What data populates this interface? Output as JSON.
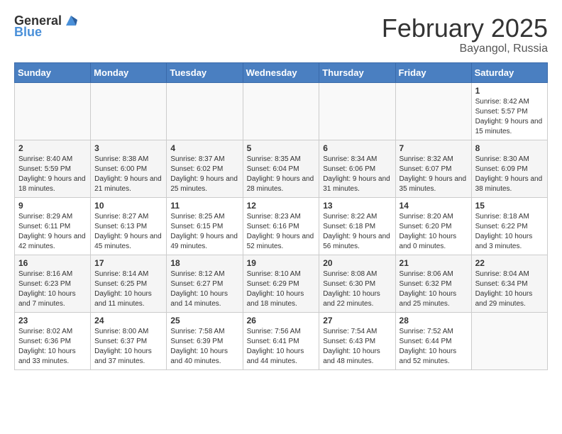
{
  "header": {
    "logo_general": "General",
    "logo_blue": "Blue",
    "month_year": "February 2025",
    "location": "Bayangol, Russia"
  },
  "days_of_week": [
    "Sunday",
    "Monday",
    "Tuesday",
    "Wednesday",
    "Thursday",
    "Friday",
    "Saturday"
  ],
  "weeks": [
    {
      "days": [
        {
          "number": "",
          "info": ""
        },
        {
          "number": "",
          "info": ""
        },
        {
          "number": "",
          "info": ""
        },
        {
          "number": "",
          "info": ""
        },
        {
          "number": "",
          "info": ""
        },
        {
          "number": "",
          "info": ""
        },
        {
          "number": "1",
          "info": "Sunrise: 8:42 AM\nSunset: 5:57 PM\nDaylight: 9 hours and 15 minutes."
        }
      ]
    },
    {
      "days": [
        {
          "number": "2",
          "info": "Sunrise: 8:40 AM\nSunset: 5:59 PM\nDaylight: 9 hours and 18 minutes."
        },
        {
          "number": "3",
          "info": "Sunrise: 8:38 AM\nSunset: 6:00 PM\nDaylight: 9 hours and 21 minutes."
        },
        {
          "number": "4",
          "info": "Sunrise: 8:37 AM\nSunset: 6:02 PM\nDaylight: 9 hours and 25 minutes."
        },
        {
          "number": "5",
          "info": "Sunrise: 8:35 AM\nSunset: 6:04 PM\nDaylight: 9 hours and 28 minutes."
        },
        {
          "number": "6",
          "info": "Sunrise: 8:34 AM\nSunset: 6:06 PM\nDaylight: 9 hours and 31 minutes."
        },
        {
          "number": "7",
          "info": "Sunrise: 8:32 AM\nSunset: 6:07 PM\nDaylight: 9 hours and 35 minutes."
        },
        {
          "number": "8",
          "info": "Sunrise: 8:30 AM\nSunset: 6:09 PM\nDaylight: 9 hours and 38 minutes."
        }
      ]
    },
    {
      "days": [
        {
          "number": "9",
          "info": "Sunrise: 8:29 AM\nSunset: 6:11 PM\nDaylight: 9 hours and 42 minutes."
        },
        {
          "number": "10",
          "info": "Sunrise: 8:27 AM\nSunset: 6:13 PM\nDaylight: 9 hours and 45 minutes."
        },
        {
          "number": "11",
          "info": "Sunrise: 8:25 AM\nSunset: 6:15 PM\nDaylight: 9 hours and 49 minutes."
        },
        {
          "number": "12",
          "info": "Sunrise: 8:23 AM\nSunset: 6:16 PM\nDaylight: 9 hours and 52 minutes."
        },
        {
          "number": "13",
          "info": "Sunrise: 8:22 AM\nSunset: 6:18 PM\nDaylight: 9 hours and 56 minutes."
        },
        {
          "number": "14",
          "info": "Sunrise: 8:20 AM\nSunset: 6:20 PM\nDaylight: 10 hours and 0 minutes."
        },
        {
          "number": "15",
          "info": "Sunrise: 8:18 AM\nSunset: 6:22 PM\nDaylight: 10 hours and 3 minutes."
        }
      ]
    },
    {
      "days": [
        {
          "number": "16",
          "info": "Sunrise: 8:16 AM\nSunset: 6:23 PM\nDaylight: 10 hours and 7 minutes."
        },
        {
          "number": "17",
          "info": "Sunrise: 8:14 AM\nSunset: 6:25 PM\nDaylight: 10 hours and 11 minutes."
        },
        {
          "number": "18",
          "info": "Sunrise: 8:12 AM\nSunset: 6:27 PM\nDaylight: 10 hours and 14 minutes."
        },
        {
          "number": "19",
          "info": "Sunrise: 8:10 AM\nSunset: 6:29 PM\nDaylight: 10 hours and 18 minutes."
        },
        {
          "number": "20",
          "info": "Sunrise: 8:08 AM\nSunset: 6:30 PM\nDaylight: 10 hours and 22 minutes."
        },
        {
          "number": "21",
          "info": "Sunrise: 8:06 AM\nSunset: 6:32 PM\nDaylight: 10 hours and 25 minutes."
        },
        {
          "number": "22",
          "info": "Sunrise: 8:04 AM\nSunset: 6:34 PM\nDaylight: 10 hours and 29 minutes."
        }
      ]
    },
    {
      "days": [
        {
          "number": "23",
          "info": "Sunrise: 8:02 AM\nSunset: 6:36 PM\nDaylight: 10 hours and 33 minutes."
        },
        {
          "number": "24",
          "info": "Sunrise: 8:00 AM\nSunset: 6:37 PM\nDaylight: 10 hours and 37 minutes."
        },
        {
          "number": "25",
          "info": "Sunrise: 7:58 AM\nSunset: 6:39 PM\nDaylight: 10 hours and 40 minutes."
        },
        {
          "number": "26",
          "info": "Sunrise: 7:56 AM\nSunset: 6:41 PM\nDaylight: 10 hours and 44 minutes."
        },
        {
          "number": "27",
          "info": "Sunrise: 7:54 AM\nSunset: 6:43 PM\nDaylight: 10 hours and 48 minutes."
        },
        {
          "number": "28",
          "info": "Sunrise: 7:52 AM\nSunset: 6:44 PM\nDaylight: 10 hours and 52 minutes."
        },
        {
          "number": "",
          "info": ""
        }
      ]
    }
  ]
}
